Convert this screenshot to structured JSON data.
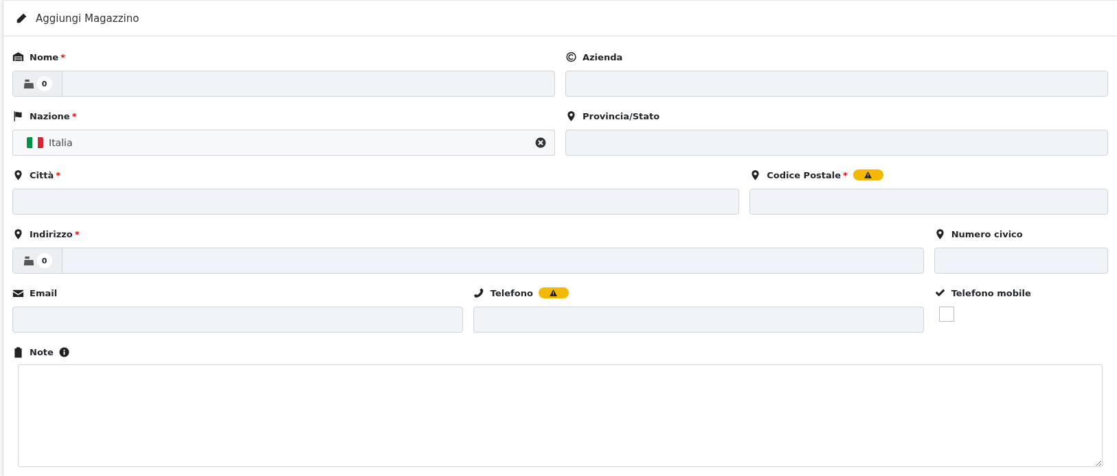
{
  "card": {
    "title": "Aggiungi Magazzino"
  },
  "rows": [
    [
      {
        "label": "Nome",
        "required_mark": "*",
        "warning": false,
        "kind": "counter",
        "counter": "0"
      },
      {
        "label": "Azienda",
        "warning": false,
        "kind": "text"
      }
    ],
    [
      {
        "label": "Nazione",
        "required_mark": "*",
        "warning": false,
        "kind": "select",
        "value": "Italia"
      },
      {
        "label": "Provincia/Stato",
        "warning": false,
        "kind": "text"
      }
    ],
    [
      {
        "label": "Città",
        "required_mark": "*",
        "warning": false,
        "kind": "text"
      },
      {
        "label": "Codice Postale",
        "required_mark": "*",
        "warning": true,
        "kind": "text"
      }
    ],
    [
      {
        "label": "Indirizzo",
        "required_mark": "*",
        "warning": false,
        "kind": "counter",
        "counter": "0"
      },
      {
        "label": "Numero civico",
        "warning": false,
        "kind": "text"
      }
    ],
    [
      {
        "label": "Email",
        "warning": false,
        "kind": "text"
      },
      {
        "label": "Telefono",
        "warning": true,
        "kind": "text"
      },
      {
        "label": "Telefono mobile",
        "warning": false,
        "kind": "checkbox",
        "checked": false
      }
    ]
  ],
  "note": {
    "label": "Note",
    "info": true
  }
}
